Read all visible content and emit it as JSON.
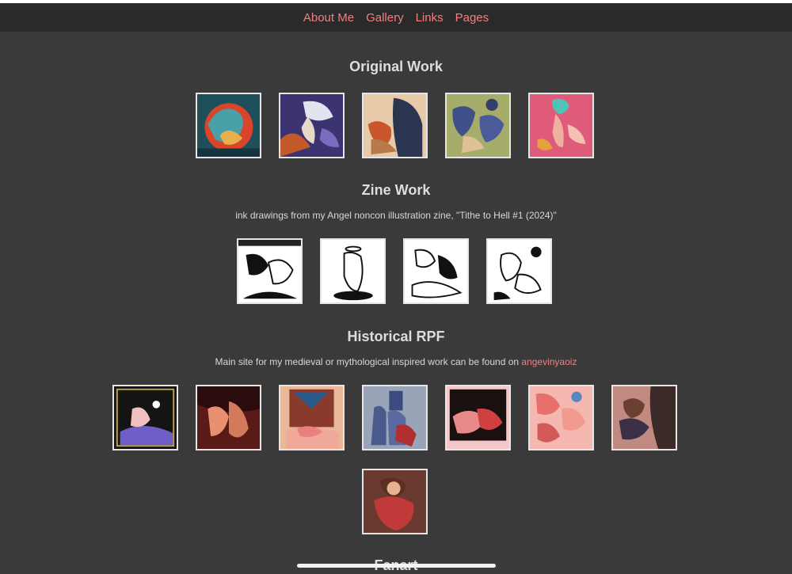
{
  "nav": {
    "about": "About Me",
    "gallery": "Gallery",
    "links": "Links",
    "pages": "Pages"
  },
  "sections": {
    "original": {
      "title": "Original Work"
    },
    "zine": {
      "title": "Zine Work",
      "description": "ink drawings from my Angel noncon illustration zine, \"Tithe to Hell #1 (2024)\""
    },
    "historical": {
      "title": "Historical RPF",
      "description_prefix": "Main site for my medieval or mythological inspired work can be found on",
      "link_text": "angevinyaoiz"
    },
    "fanart": {
      "title": "Fanart"
    }
  },
  "colors": {
    "background": "#3a3a3a",
    "navbar": "#2a2a2a",
    "link": "#f08080",
    "text": "#dddddd",
    "thumb_border": "#e6e6e6"
  },
  "thumbnails": {
    "original": [
      "artwork-thumbnail",
      "artwork-thumbnail",
      "artwork-thumbnail",
      "artwork-thumbnail",
      "artwork-thumbnail"
    ],
    "zine": [
      "artwork-thumbnail",
      "artwork-thumbnail",
      "artwork-thumbnail",
      "artwork-thumbnail"
    ],
    "historical": [
      "artwork-thumbnail",
      "artwork-thumbnail",
      "artwork-thumbnail",
      "artwork-thumbnail",
      "artwork-thumbnail",
      "artwork-thumbnail",
      "artwork-thumbnail",
      "artwork-thumbnail"
    ]
  }
}
